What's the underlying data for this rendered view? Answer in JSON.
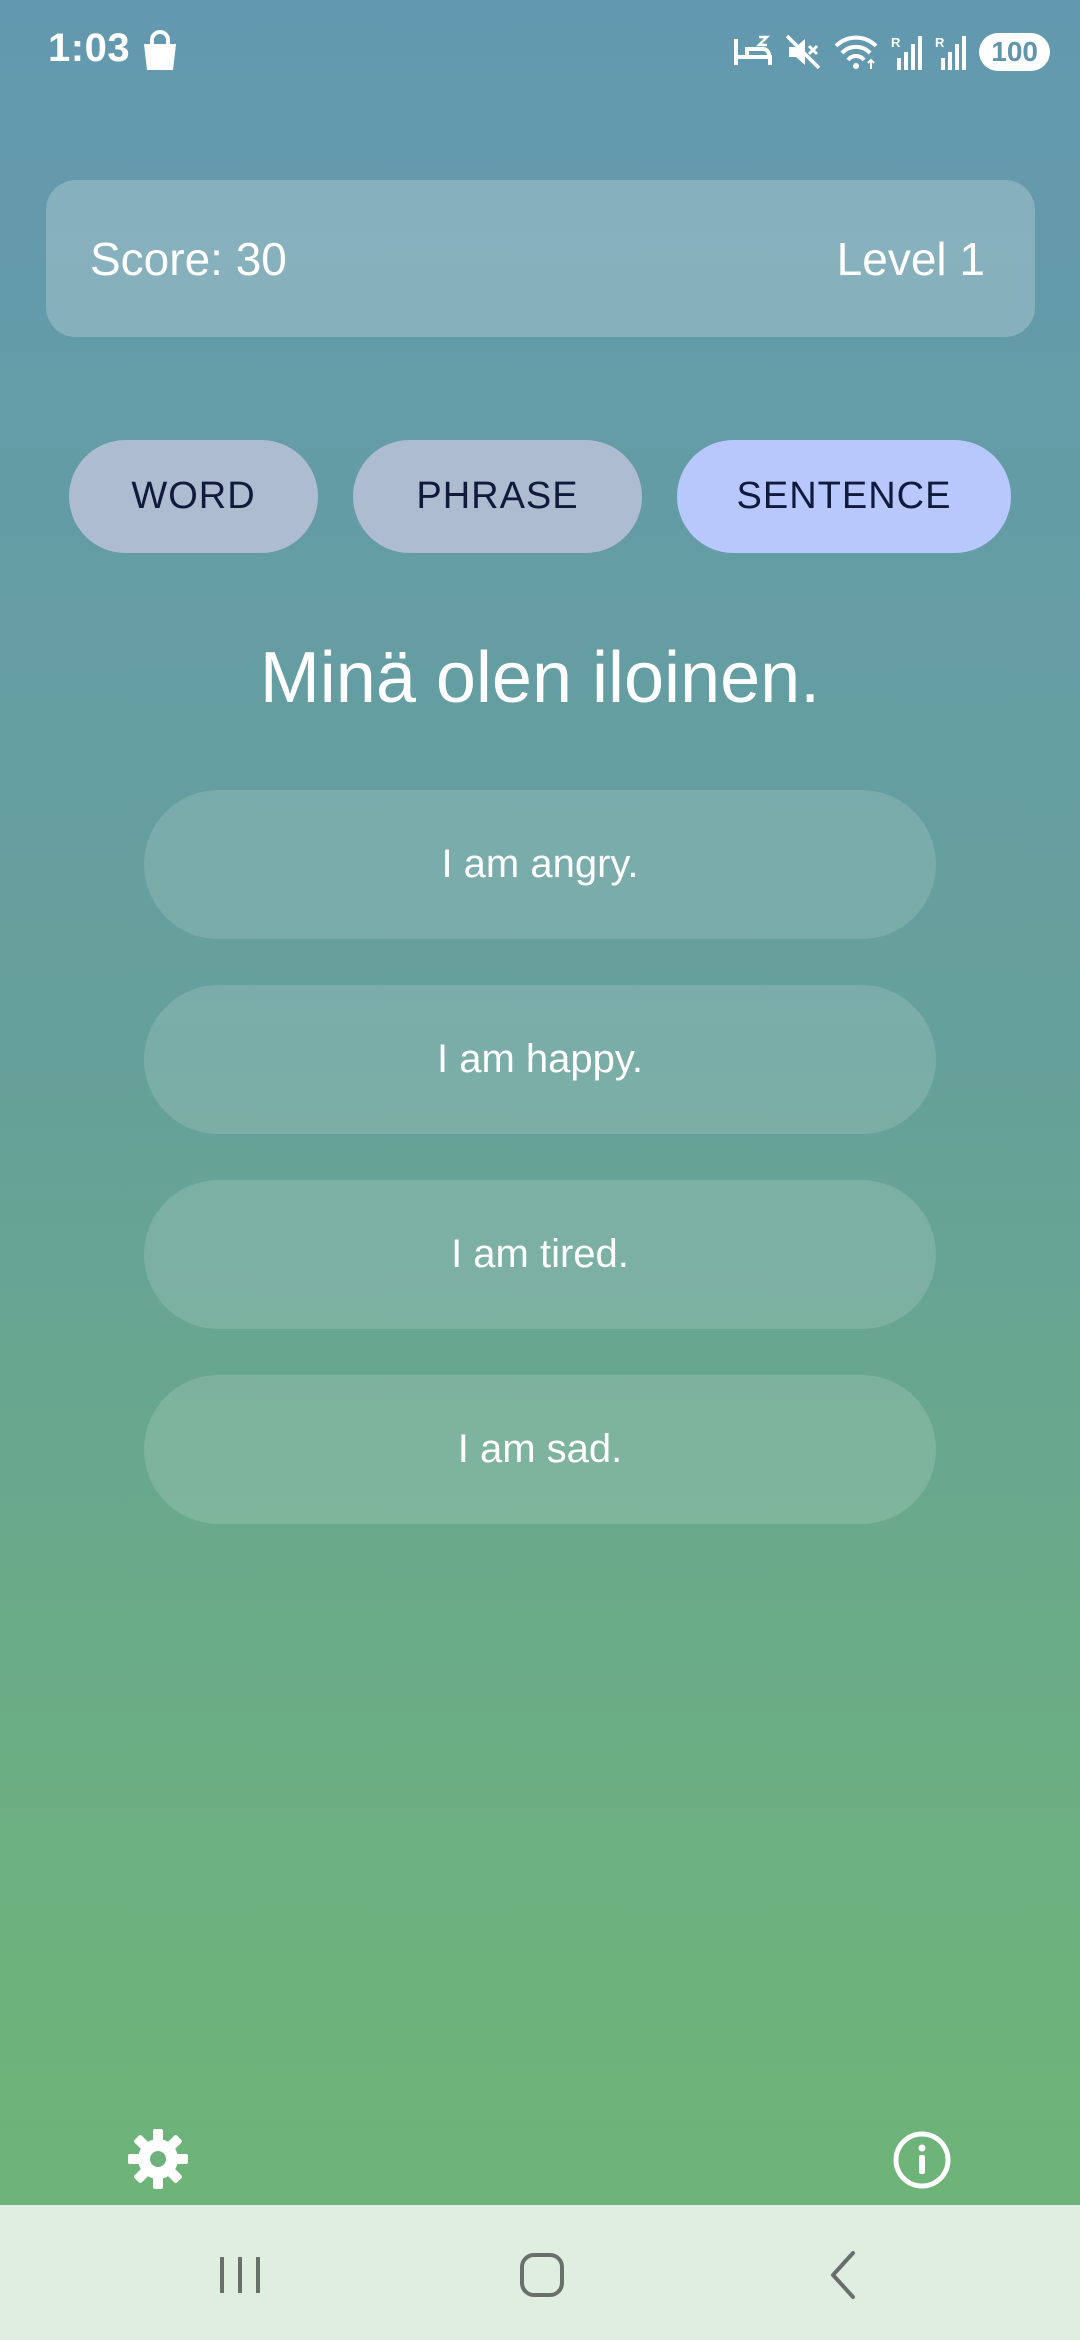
{
  "status_bar": {
    "time": "1:03",
    "battery": "100"
  },
  "score_card": {
    "score": "Score: 30",
    "level": "Level 1"
  },
  "modes": [
    {
      "label": "WORD",
      "selected": false
    },
    {
      "label": "PHRASE",
      "selected": false
    },
    {
      "label": "SENTENCE",
      "selected": true
    }
  ],
  "question": "Minä olen iloinen.",
  "options": [
    {
      "label": "I am angry."
    },
    {
      "label": "I am happy."
    },
    {
      "label": "I am tired."
    },
    {
      "label": "I am sad."
    }
  ],
  "bottom_icons": {
    "left": "gear-icon",
    "right": "info-icon"
  },
  "colors": {
    "tab_default": "#aebcd0",
    "tab_selected": "#b8c8fd",
    "tab_text": "#0f1a3d",
    "nav_bar": "#e0ede1"
  }
}
